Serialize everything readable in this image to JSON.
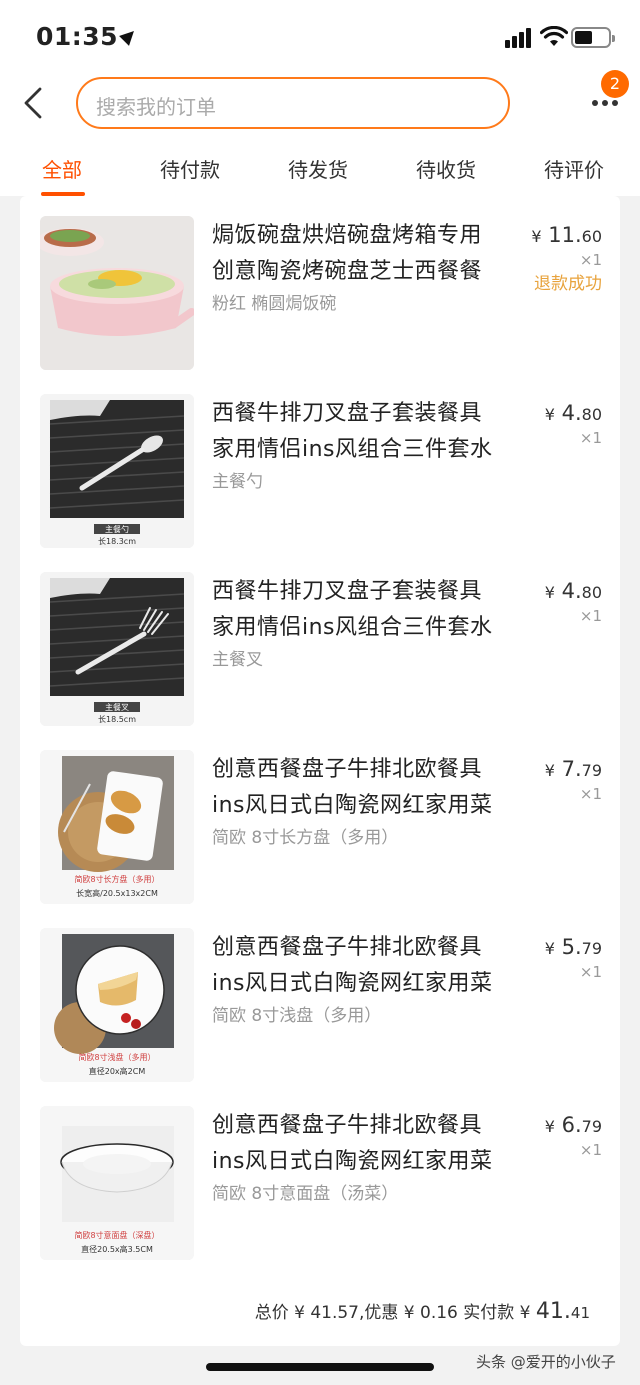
{
  "status_bar": {
    "time": "01:35"
  },
  "header": {
    "search_placeholder": "搜索我的订单",
    "notification_count": "2"
  },
  "tabs": [
    {
      "label": "全部",
      "active": true
    },
    {
      "label": "待付款",
      "active": false
    },
    {
      "label": "待发货",
      "active": false
    },
    {
      "label": "待收货",
      "active": false
    },
    {
      "label": "待评价",
      "active": false
    }
  ],
  "items": [
    {
      "title_line1": "焗饭碗盘烘焙碗盘烤箱专用",
      "title_line2": "创意陶瓷烤碗盘芝士西餐餐",
      "sku": "粉红 椭圆焗饭碗",
      "price_symbol": "¥",
      "price_int": "11.",
      "price_dec": "60",
      "qty": "×1",
      "status": "退款成功",
      "thumb_caption1": "",
      "thumb_caption2": ""
    },
    {
      "title_line1": "西餐牛排刀叉盘子套装餐具",
      "title_line2": "家用情侣ins风组合三件套水",
      "sku": "主餐勺",
      "price_symbol": "¥",
      "price_int": "4.",
      "price_dec": "80",
      "qty": "×1",
      "status": "",
      "thumb_caption1": "主餐勺",
      "thumb_caption2": "长18.3cm"
    },
    {
      "title_line1": "西餐牛排刀叉盘子套装餐具",
      "title_line2": "家用情侣ins风组合三件套水",
      "sku": "主餐叉",
      "price_symbol": "¥",
      "price_int": "4.",
      "price_dec": "80",
      "qty": "×1",
      "status": "",
      "thumb_caption1": "主餐叉",
      "thumb_caption2": "长18.5cm"
    },
    {
      "title_line1": "创意西餐盘子牛排北欧餐具",
      "title_line2": "ins风日式白陶瓷网红家用菜",
      "sku": "简欧 8寸长方盘（多用）",
      "price_symbol": "¥",
      "price_int": "7.",
      "price_dec": "79",
      "qty": "×1",
      "status": "",
      "thumb_caption1": "简欧8寸长方盘（多用）",
      "thumb_caption2": "长宽高/20.5x13x2CM"
    },
    {
      "title_line1": "创意西餐盘子牛排北欧餐具",
      "title_line2": "ins风日式白陶瓷网红家用菜",
      "sku": "简欧 8寸浅盘（多用）",
      "price_symbol": "¥",
      "price_int": "5.",
      "price_dec": "79",
      "qty": "×1",
      "status": "",
      "thumb_caption1": "简欧8寸浅盘（多用）",
      "thumb_caption2": "直径20x高2CM"
    },
    {
      "title_line1": "创意西餐盘子牛排北欧餐具",
      "title_line2": "ins风日式白陶瓷网红家用菜",
      "sku": "简欧 8寸意面盘（汤菜）",
      "price_symbol": "¥",
      "price_int": "6.",
      "price_dec": "79",
      "qty": "×1",
      "status": "",
      "thumb_caption1": "简欧8寸意面盘（深盘）",
      "thumb_caption2": "直径20.5x高3.5CM"
    }
  ],
  "summary": {
    "prefix": "总价 ¥ 41.57,优惠 ¥ 0.16 实付款 ¥ ",
    "paid_int": "41.",
    "paid_dec": "41"
  },
  "watermark": "头条 @爱开的小伙子",
  "colors": {
    "accent": "#ff5000",
    "search_border": "#ff7a1a",
    "refund": "#e8a33d",
    "badge": "#ff6a00"
  }
}
